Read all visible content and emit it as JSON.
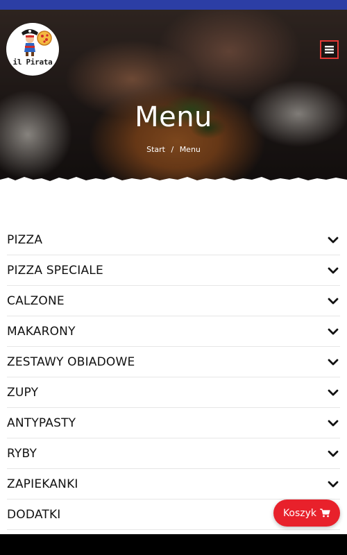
{
  "colors": {
    "status_bar": "#2c3ea5",
    "accent_red": "#e8212b",
    "text": "#111111",
    "divider": "#e6e6e6"
  },
  "logo": {
    "text": "il Pirata",
    "icon": "pirate-pizza-logo"
  },
  "header": {
    "menu_icon": "hamburger-icon"
  },
  "hero": {
    "title": "Menu",
    "breadcrumb": {
      "home": "Start",
      "separator": "/",
      "current": "Menu"
    }
  },
  "menu": {
    "categories": [
      {
        "label": "PIZZA",
        "icon": "chevron-down-icon"
      },
      {
        "label": "PIZZA SPECIALE",
        "icon": "chevron-down-icon"
      },
      {
        "label": "CALZONE",
        "icon": "chevron-down-icon"
      },
      {
        "label": "MAKARONY",
        "icon": "chevron-down-icon"
      },
      {
        "label": "ZESTAWY OBIADOWE",
        "icon": "chevron-down-icon"
      },
      {
        "label": "ZUPY",
        "icon": "chevron-down-icon"
      },
      {
        "label": "ANTYPASTY",
        "icon": "chevron-down-icon"
      },
      {
        "label": "RYBY",
        "icon": "chevron-down-icon"
      },
      {
        "label": "ZAPIEKANKI",
        "icon": "chevron-down-icon"
      },
      {
        "label": "DODATKI",
        "icon": "chevron-down-icon"
      }
    ]
  },
  "cart": {
    "label": "Koszyk",
    "icon": "shopping-cart-icon"
  }
}
